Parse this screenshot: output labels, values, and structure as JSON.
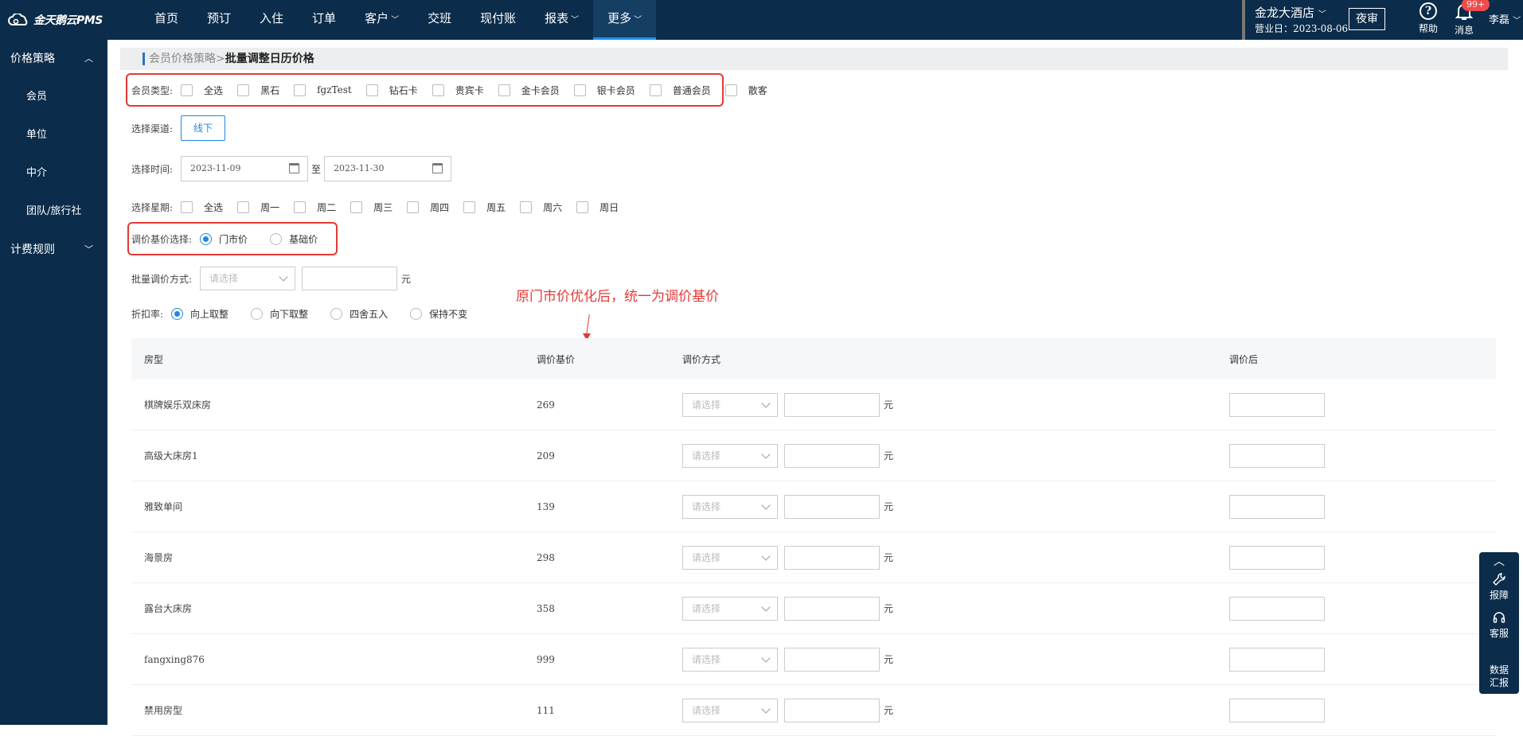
{
  "app": {
    "logo_text": "金天鹅云PMS"
  },
  "nav": [
    "首页",
    "预订",
    "入住",
    "订单",
    "客户",
    "交班",
    "现付账",
    "报表",
    "更多"
  ],
  "nav_dropdowns": [
    "客户",
    "报表",
    "更多"
  ],
  "nav_active": "更多",
  "header": {
    "hotel": "金龙大酒店",
    "business_date": "营业日：2023-08-06",
    "night_audit": "夜审",
    "help": "帮助",
    "help_icon": "?",
    "messages": "消息",
    "message_badge": "99+",
    "user": "李磊"
  },
  "sidebar": {
    "group1": "价格策略",
    "items": [
      "会员",
      "单位",
      "中介",
      "团队/旅行社"
    ],
    "group2": "计费规则"
  },
  "breadcrumb": {
    "parent": "会员价格策略",
    "sep": ">",
    "current": "批量调整日历价格"
  },
  "member_type": {
    "label": "会员类型:",
    "options": [
      "全选",
      "黑石",
      "fgzTest",
      "钻石卡",
      "贵宾卡",
      "金卡会员",
      "银卡会员",
      "普通会员",
      "散客"
    ]
  },
  "channel": {
    "label": "选择渠道:",
    "value": "线下"
  },
  "time": {
    "label": "选择时间:",
    "start": "2023-11-09",
    "to": "至",
    "end": "2023-11-30"
  },
  "weekday": {
    "label": "选择星期:",
    "options": [
      "全选",
      "周一",
      "周二",
      "周三",
      "周四",
      "周五",
      "周六",
      "周日"
    ]
  },
  "base_price": {
    "label": "调价基价选择:",
    "options": [
      "门市价",
      "基础价"
    ],
    "selected": "门市价"
  },
  "batch": {
    "label": "批量调价方式:",
    "placeholder": "请选择",
    "unit": "元"
  },
  "discount": {
    "label": "折扣率:",
    "options": [
      "向上取整",
      "向下取整",
      "四舍五入",
      "保持不变"
    ],
    "selected": "向上取整"
  },
  "annotation": "原门市价优化后，统一为调价基价",
  "table": {
    "headers": [
      "房型",
      "调价基价",
      "调价方式",
      "调价后"
    ],
    "select_placeholder": "请选择",
    "unit": "元",
    "rows": [
      {
        "room": "棋牌娱乐双床房",
        "price": "269"
      },
      {
        "room": "高级大床房1",
        "price": "209"
      },
      {
        "room": "雅致单间",
        "price": "139"
      },
      {
        "room": "海景房",
        "price": "298"
      },
      {
        "room": "露台大床房",
        "price": "358"
      },
      {
        "room": "fangxing876",
        "price": "999"
      },
      {
        "room": "禁用房型",
        "price": "111"
      }
    ]
  },
  "float_panel": {
    "items": [
      "报障",
      "客服",
      "数据\n汇报"
    ]
  },
  "colors": {
    "nav_bg": "#0b2c4a",
    "accent": "#1e88e5",
    "highlight": "#e53935"
  }
}
